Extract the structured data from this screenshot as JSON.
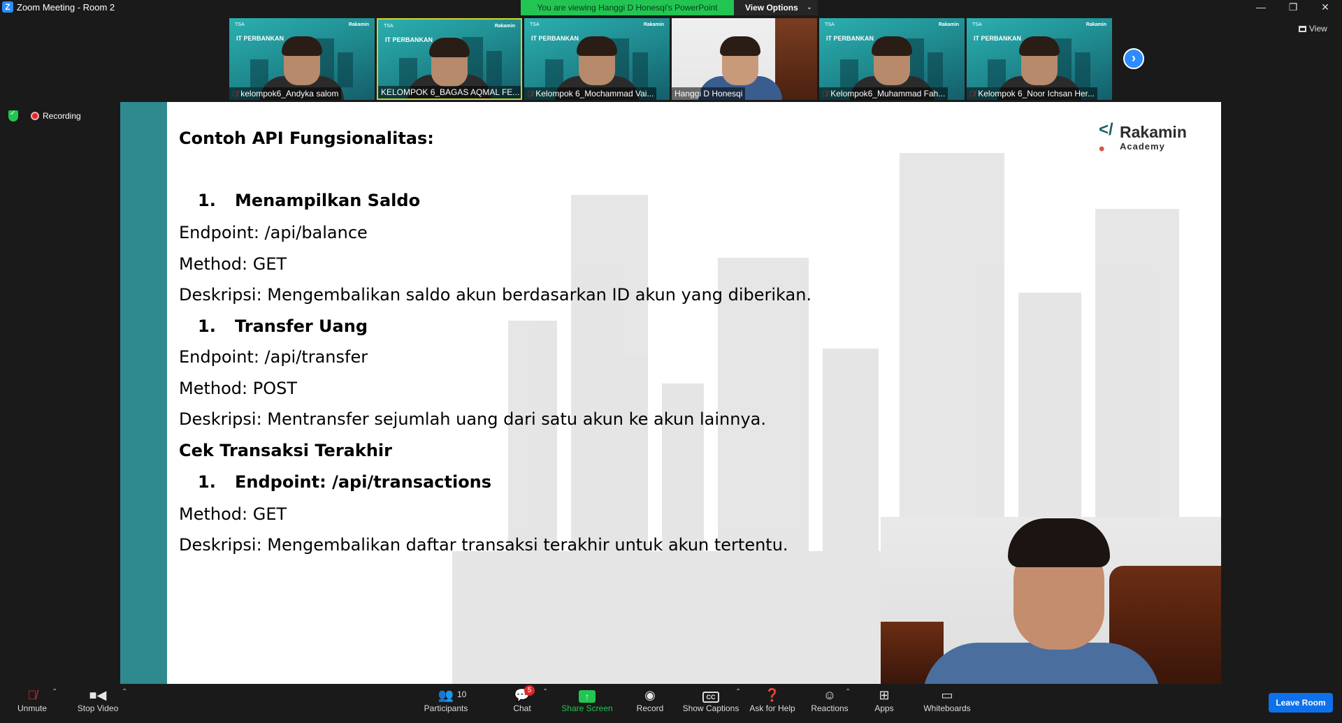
{
  "window": {
    "title": "Zoom Meeting - Room 2",
    "app_icon": "zoom-logo-icon",
    "controls": [
      "minimize-icon",
      "restore-icon",
      "close-icon"
    ]
  },
  "share_banner": {
    "text": "You are viewing Hanggi D Honesqi's PowerPoint",
    "view_options_label": "View Options",
    "color": "#23c552"
  },
  "top_right": {
    "view_label": "View"
  },
  "participants": [
    {
      "name": "kelompok6_Andyka salom",
      "muted": true,
      "tile_header": "IT PERBANKAN",
      "tile_logo": "TSA",
      "tile_brand": "Rakamin"
    },
    {
      "name": "KELOMPOK 6_BAGAS AQMAL FE...",
      "muted": false,
      "active": true,
      "tile_header": "IT PERBANKAN",
      "tile_logo": "TSA",
      "tile_brand": "Rakamin"
    },
    {
      "name": "Kelompok 6_Mochammad Vai...",
      "muted": true,
      "tile_header": "IT PERBANKAN",
      "tile_logo": "TSA",
      "tile_brand": "Rakamin"
    },
    {
      "name": "Hanggi D Honesqi",
      "muted": false
    },
    {
      "name": "Kelompok6_Muhammad Fah...",
      "muted": true,
      "tile_header": "IT PERBANKAN",
      "tile_logo": "TSA",
      "tile_brand": "Rakamin"
    },
    {
      "name": "Kelompok 6_Noor Ichsan Her...",
      "muted": true,
      "tile_header": "IT PERBANKAN",
      "tile_logo": "TSA",
      "tile_brand": "Rakamin"
    }
  ],
  "recording": {
    "label": "Recording"
  },
  "slide": {
    "brand_name": "Rakamin",
    "brand_sub": "Academy",
    "lines": [
      {
        "text": "Contoh API Fungsionalitas:",
        "bold": true
      },
      {
        "num": "1.",
        "text": "Menampilkan Saldo",
        "bold": true
      },
      {
        "text": "Endpoint: /api/balance"
      },
      {
        "text": "Method: GET"
      },
      {
        "text": "Deskripsi: Mengembalikan saldo akun berdasarkan ID akun yang diberikan."
      },
      {
        "num": "1.",
        "text": "Transfer Uang",
        "bold": true
      },
      {
        "text": "Endpoint: /api/transfer"
      },
      {
        "text": "Method: POST"
      },
      {
        "text": "Deskripsi: Mentransfer sejumlah uang dari satu akun ke akun lainnya."
      },
      {
        "text": "Cek Transaksi Terakhir",
        "bold": true
      },
      {
        "num": "1.",
        "text": "Endpoint: /api/transactions",
        "bold": true
      },
      {
        "text": "Method: GET"
      },
      {
        "text": "Deskripsi: Mengembalikan daftar transaksi terakhir untuk akun tertentu."
      }
    ]
  },
  "toolbar": {
    "unmute": "Unmute",
    "stop_video": "Stop Video",
    "participants": "Participants",
    "participants_count": "10",
    "chat": "Chat",
    "chat_badge": "5",
    "share_screen": "Share Screen",
    "record": "Record",
    "show_captions": "Show Captions",
    "captions_icon_text": "CC",
    "ask_for_help": "Ask for Help",
    "reactions": "Reactions",
    "apps": "Apps",
    "whiteboards": "Whiteboards",
    "leave_room": "Leave Room"
  }
}
